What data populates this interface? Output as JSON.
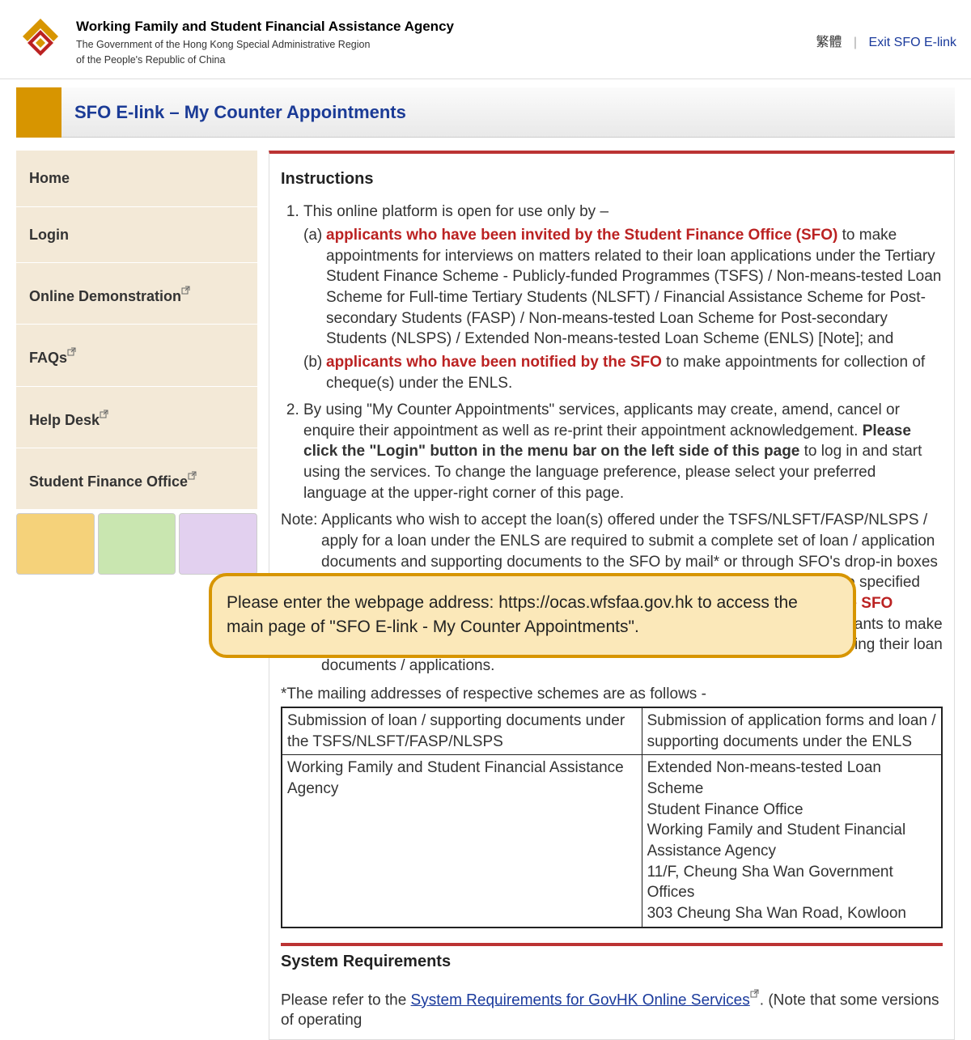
{
  "header": {
    "agency_title": "Working Family and Student Financial Assistance Agency",
    "agency_sub1": "The Government of the Hong Kong Special Administrative Region",
    "agency_sub2": "of the People's Republic of China",
    "lang_label": "繁體",
    "separator": "|",
    "exit_label": "Exit SFO E-link"
  },
  "page_title": "SFO E-link – My Counter Appointments",
  "sidebar": {
    "items": [
      {
        "label": "Home",
        "external": false
      },
      {
        "label": "Login",
        "external": false
      },
      {
        "label": "Online Demonstration",
        "external": true
      },
      {
        "label": "FAQs",
        "external": true
      },
      {
        "label": "Help Desk",
        "external": true
      },
      {
        "label": "Student Finance Office",
        "external": true
      }
    ]
  },
  "instructions": {
    "heading": "Instructions",
    "item1_intro": "This online platform is open for use only by –",
    "item1_a_lbl": "(a)",
    "item1_a_red": "applicants who have been invited by the Student Finance Office (SFO)",
    "item1_a_rest": " to make appointments for interviews on matters related to their loan applications under the Tertiary Student Finance Scheme - Publicly-funded Programmes (TSFS) / Non-means-tested Loan Scheme for Full-time Tertiary Students (NLSFT) / Financial Assistance Scheme for Post-secondary Students (FASP) / Non-means-tested Loan Scheme for Post-secondary Students (NLSPS) / Extended Non-means-tested Loan Scheme (ENLS) [Note]; and",
    "item1_b_lbl": "(b)",
    "item1_b_red": "applicants who have been notified by the SFO",
    "item1_b_rest": " to make appointments for collection of cheque(s) under the ENLS.",
    "item2_part1": "By using \"My Counter Appointments\" services, applicants may create, amend, cancel or enquire their appointment as well as re-print their appointment acknowledgement. ",
    "item2_bold": "Please click the \"Login\" button in the menu bar on the left side of this page",
    "item2_part2": " to log in and start using the services. To change the language preference, please select your preferred language at the upper-right corner of this page.",
    "note_label": "Note:",
    "note_part1": "Applicants who wish to accept the loan(s) offered under the TSFS/NLSFT/FASP/NLSPS / apply for a loan under the ENLS are required to submit a complete set of loan / application documents and supporting documents to the SFO by mail* or through SFO's drop-in boxes (Address: 11/F or G/F, Cheung Sha Wan Government Offices) on or before the specified deadline. ",
    "note_red": "Applicants are not required to submit relevant documents to the SFO counters in person.",
    "note_part2": " After preliminary vetting, the SFO may invite some applicants to make appointments through this platform for interviews at counter for further processing their loan documents / applications.",
    "mail_intro": "*The mailing addresses of respective schemes are as follows -",
    "table": {
      "h1": "Submission of loan / supporting documents under the TSFS/NLSFT/FASP/NLSPS",
      "h2": "Submission of application forms and loan / supporting documents under the ENLS",
      "c1_l1": "",
      "c1_l2": "Working Family and Student Financial Assistance Agency",
      "c1_l3": "",
      "c2_l1": "Extended Non-means-tested Loan Scheme",
      "c2_l2": "Student Finance Office",
      "c2_l3": "Working Family and Student Financial Assistance Agency",
      "c2_l4": "11/F, Cheung Sha Wan Government Offices",
      "c2_l5": "303 Cheung Sha Wan Road, Kowloon"
    },
    "sysreq_heading": "System Requirements",
    "sysreq_lead": "Please refer to the ",
    "sysreq_link": "System Requirements for GovHK Online Services",
    "sysreq_tail": ". (Note that some versions of operating"
  },
  "tooltip": {
    "text": "Please enter the webpage address: https://ocas.wfsfaa.gov.hk to access the main page of \"SFO E-link - My Counter Appointments\"."
  }
}
